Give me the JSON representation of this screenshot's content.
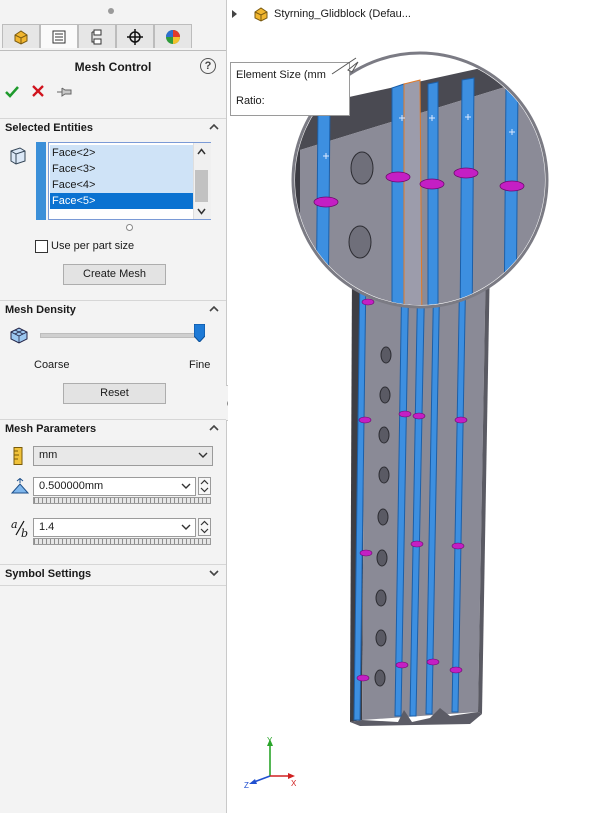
{
  "panel": {
    "title": "Mesh Control",
    "help_icon": "?",
    "ok_icon": "checkmark-icon",
    "cancel_icon": "x-icon",
    "pin_icon": "pushpin-icon",
    "tabs": [
      {
        "icon": "feature-manager-icon"
      },
      {
        "icon": "property-manager-icon"
      },
      {
        "icon": "configuration-manager-icon"
      },
      {
        "icon": "dimxpert-icon"
      },
      {
        "icon": "appearance-icon"
      }
    ]
  },
  "selected_entities": {
    "title": "Selected Entities",
    "items": [
      "Face<2>",
      "Face<3>",
      "Face<4>",
      "Face<5>"
    ],
    "selected_index": 3,
    "use_per_part_label": "Use per part size",
    "use_per_part_checked": false,
    "create_mesh_label": "Create Mesh"
  },
  "mesh_density": {
    "title": "Mesh Density",
    "coarse_label": "Coarse",
    "fine_label": "Fine",
    "slider_value": 1.0,
    "reset_label": "Reset"
  },
  "mesh_parameters": {
    "title": "Mesh Parameters",
    "units": "mm",
    "element_size": "0.500000mm",
    "ratio": "1.4"
  },
  "symbol_settings": {
    "title": "Symbol Settings"
  },
  "viewport": {
    "tree_label": "Styrning_Glidblock (Defau...",
    "callout_line1": "Element Size (mm",
    "callout_line2": "Ratio:",
    "axis_x": "X",
    "axis_y": "Y",
    "axis_z": "Z"
  },
  "colors": {
    "accent_blue": "#0a72d1",
    "face_highlight": "#3d8fe0",
    "mesh_symbol": "#c41fc4",
    "ok_green": "#1e9a2c",
    "cancel_red": "#d0131d"
  }
}
